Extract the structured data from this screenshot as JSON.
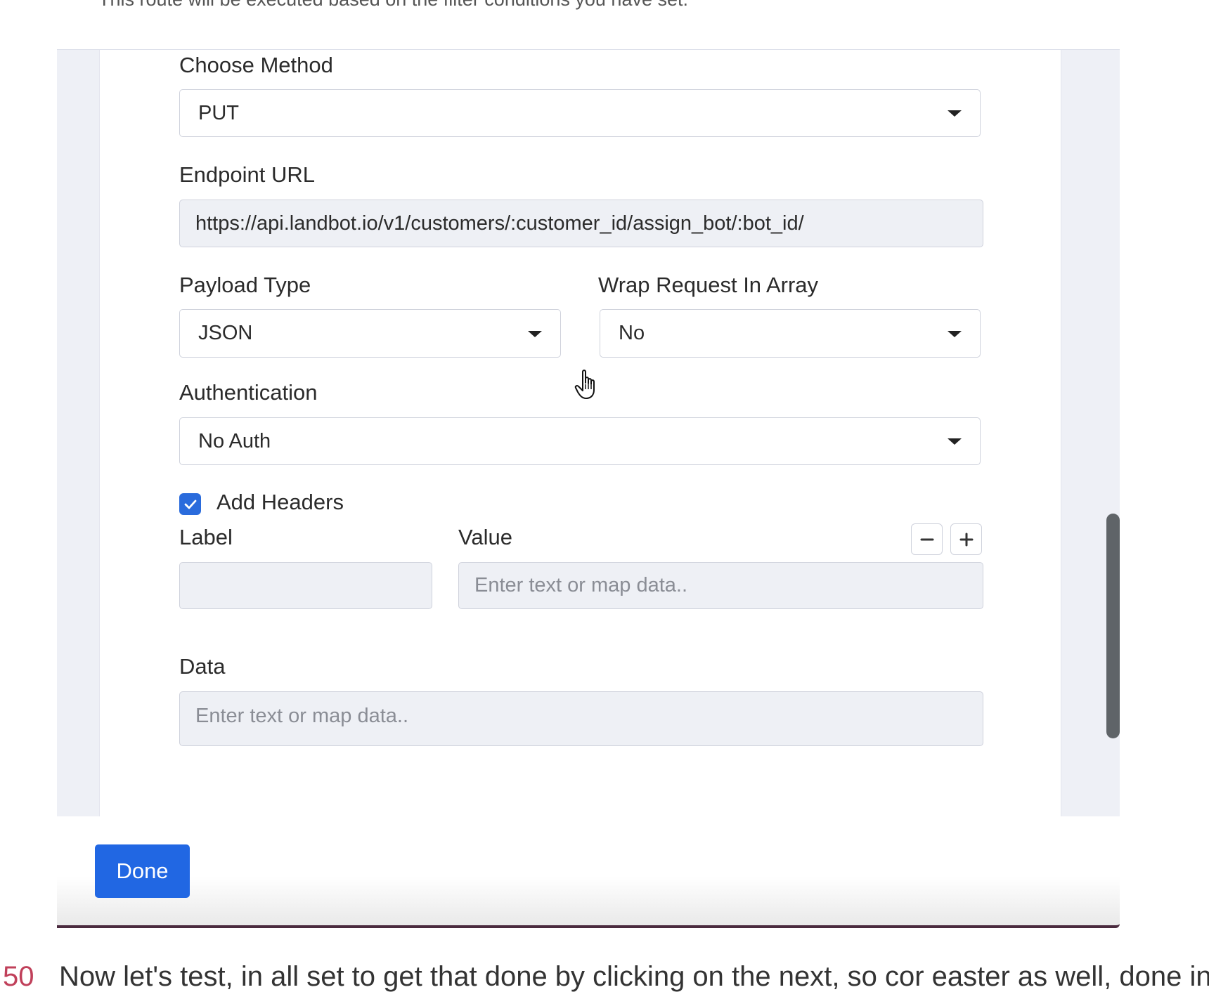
{
  "top_note": "This route will be executed based on the filter conditions you have set.",
  "form": {
    "method": {
      "label": "Choose Method",
      "value": "PUT"
    },
    "endpoint": {
      "label": "Endpoint URL",
      "value": "https://api.landbot.io/v1/customers/:customer_id/assign_bot/:bot_id/"
    },
    "payload_type": {
      "label": "Payload Type",
      "value": "JSON"
    },
    "wrap_request": {
      "label": "Wrap Request In Array",
      "value": "No"
    },
    "authentication": {
      "label": "Authentication",
      "value": "No Auth"
    },
    "add_headers": {
      "label": "Add Headers",
      "checked": true
    },
    "headers": {
      "label_col": "Label",
      "value_col": "Value",
      "label_value": "",
      "value_placeholder": "Enter text or map data.."
    },
    "data": {
      "label": "Data",
      "placeholder": "Enter text or map data.."
    }
  },
  "footer": {
    "done_label": "Done"
  },
  "bottom": {
    "number": "50",
    "text": "Now let's test, in all set to get that done by clicking on the next, so cor easter as well, done in th"
  },
  "colors": {
    "primary": "#2167e3",
    "checkbox": "#2a6bdc",
    "scrollbar": "#5f6468"
  }
}
